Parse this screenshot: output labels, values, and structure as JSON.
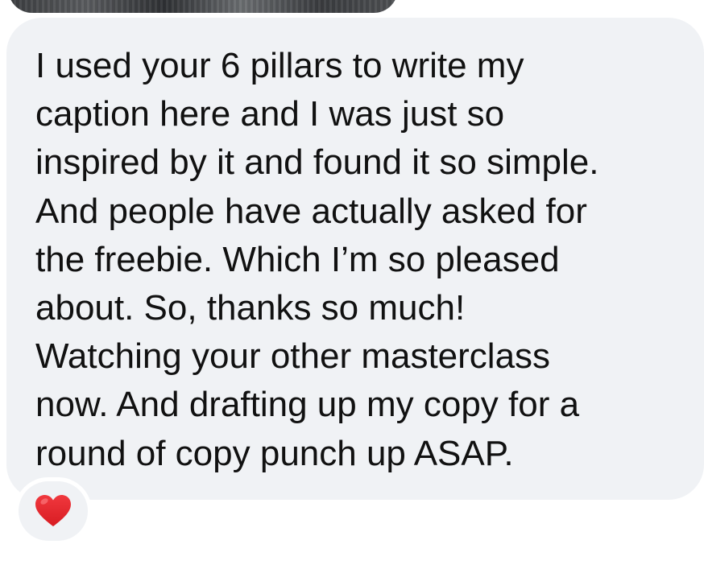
{
  "message": {
    "text": "I used your 6 pillars to write my\ncaption here and I was just so\ninspired by it and found it so simple.\nAnd people have actually asked for\nthe freebie. Which I’m so pleased\nabout. So, thanks so much!\nWatching your other masterclass\nnow. And drafting up my copy for a\nround of copy punch up ASAP."
  },
  "reaction": {
    "icon": "red-heart-icon",
    "color": "#e0242a"
  },
  "colors": {
    "bubble_background": "#f0f2f5",
    "text": "#111111",
    "page_background": "#ffffff"
  }
}
